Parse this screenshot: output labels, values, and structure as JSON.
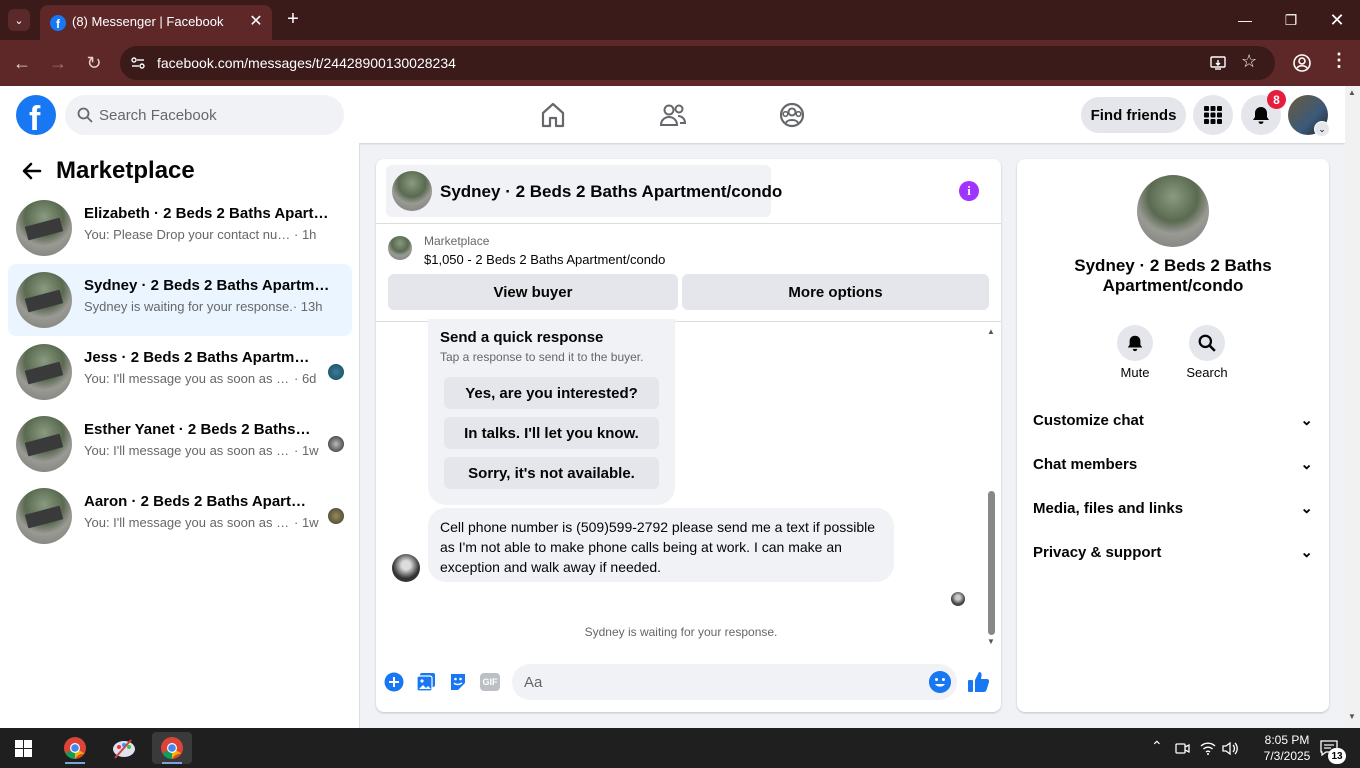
{
  "browser": {
    "tab_title": "(8) Messenger | Facebook",
    "url": "facebook.com/messages/t/24428900130028234"
  },
  "fb": {
    "search_placeholder": "Search Facebook",
    "find_friends": "Find friends",
    "notification_count": "8"
  },
  "sidebar": {
    "title": "Marketplace",
    "conversations": [
      {
        "name": "Elizabeth · 2 Beds 2 Baths Apartm...",
        "preview": "You: Please Drop your contact numbe...",
        "time": "· 1h",
        "active": false
      },
      {
        "name": "Sydney · 2 Beds 2 Baths Apartmen...",
        "preview": "Sydney is waiting for your response.",
        "time": "· 13h",
        "active": true
      },
      {
        "name": "Jess · 2 Beds 2 Baths Apartment...",
        "preview": "You: I'll message you as soon as po...",
        "time": "· 6d",
        "active": false
      },
      {
        "name": "Esther Yanet · 2 Beds 2 Baths Ap...",
        "preview": "You: I'll message you as soon as po...",
        "time": "· 1w",
        "active": false
      },
      {
        "name": "Aaron · 2 Beds 2 Baths Apartme...",
        "preview": "You: I'll message you as soon as po...",
        "time": "· 1w",
        "active": false
      }
    ]
  },
  "chat": {
    "title": "Sydney · 2 Beds 2 Baths Apartment/condo",
    "listing_label": "Marketplace",
    "listing_price": "$1,050 - 2 Beds 2 Baths Apartment/condo",
    "view_buyer": "View buyer",
    "more_options": "More options",
    "quick_title": "Send a quick response",
    "quick_sub": "Tap a response to send it to the buyer.",
    "quick_responses": [
      "Yes, are you interested?",
      "In talks. I'll let you know.",
      "Sorry, it's not available."
    ],
    "message": "Cell phone number is (509)599-2792 please send me a text if possible as I'm not able to make phone calls being at work. I can make an exception and walk away if needed.",
    "waiting": "Sydney is waiting for your response.",
    "composer_placeholder": "Aa",
    "gif_label": "GIF"
  },
  "rpanel": {
    "title": "Sydney · 2 Beds 2 Baths Apartment/condo",
    "mute": "Mute",
    "search": "Search",
    "items": [
      "Customize chat",
      "Chat members",
      "Media, files and links",
      "Privacy & support"
    ]
  },
  "taskbar": {
    "time": "8:05 PM",
    "date": "7/3/2025",
    "notif_count": "13"
  },
  "colors": {
    "facebook_blue": "#1877f2",
    "browser_frame": "#5e2828",
    "active_conv": "#ebf5ff",
    "info_purple": "#a033ff",
    "badge_red": "#e41e3f"
  }
}
